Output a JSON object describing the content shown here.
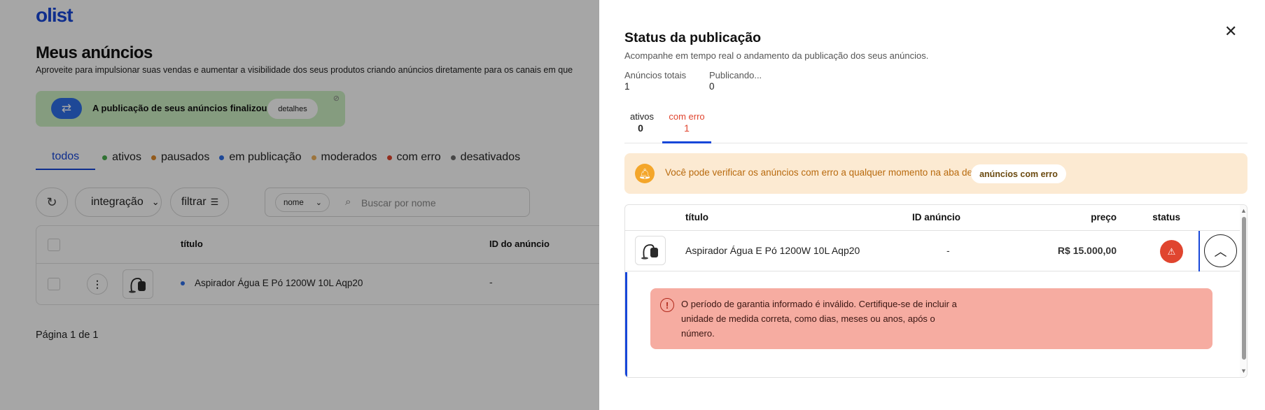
{
  "app": {
    "logo": "olist"
  },
  "page": {
    "title": "Meus anúncios",
    "subtitle": "Aproveite para impulsionar suas vendas e aumentar a visibilidade dos seus produtos criando anúncios diretamente para os canais em que"
  },
  "banner": {
    "text": "A publicação de seus anúncios finalizou",
    "button": "detalhes"
  },
  "filters": {
    "tabs": [
      {
        "label": "todos",
        "color": ""
      },
      {
        "label": "ativos",
        "color": "#4caf50"
      },
      {
        "label": "pausados",
        "color": "#e08a2a"
      },
      {
        "label": "em publicação",
        "color": "#2f6fe8"
      },
      {
        "label": "moderados",
        "color": "#f0b35c"
      },
      {
        "label": "com erro",
        "color": "#e0452f"
      },
      {
        "label": "desativados",
        "color": "#6d6d6d"
      }
    ]
  },
  "toolbar": {
    "integration": "integração",
    "filter": "filtrar",
    "search_select": "nome",
    "search_placeholder": "Buscar por nome"
  },
  "list": {
    "columns": [
      "título",
      "ID do anúncio"
    ],
    "rows": [
      {
        "title": "Aspirador Água E Pó 1200W 10L Aqp20",
        "id": "-"
      }
    ]
  },
  "pagination": "Página 1 de 1",
  "drawer": {
    "title": "Status da publicação",
    "subtitle": "Acompanhe em tempo real o andamento da publicação dos seus anúncios.",
    "stats": [
      {
        "label": "Anúncios totais",
        "value": "1"
      },
      {
        "label": "Publicando...",
        "value": "0"
      }
    ],
    "tabs": [
      {
        "label": "ativos",
        "value": "0"
      },
      {
        "label": "com erro",
        "value": "1"
      }
    ],
    "info": {
      "text": "Você pode verificar os anúncios com erro a qualquer momento na aba de",
      "link": "anúncios com erro"
    },
    "table": {
      "columns": [
        "título",
        "ID anúncio",
        "preço",
        "status"
      ],
      "rows": [
        {
          "title": "Aspirador Água E Pó 1200W 10L Aqp20",
          "id": "-",
          "price": "R$ 15.000,00",
          "status": "erro"
        }
      ],
      "error_message": "O período de garantia informado é inválido. Certifique-se de incluir a unidade de medida correta, como dias, meses ou anos, após o número."
    }
  },
  "colors": {
    "brand": "#1747d9",
    "error": "#e0452f",
    "warning_bg": "#fcead2",
    "error_bg": "#f6aca1",
    "success_bg": "#cdf0c4"
  }
}
